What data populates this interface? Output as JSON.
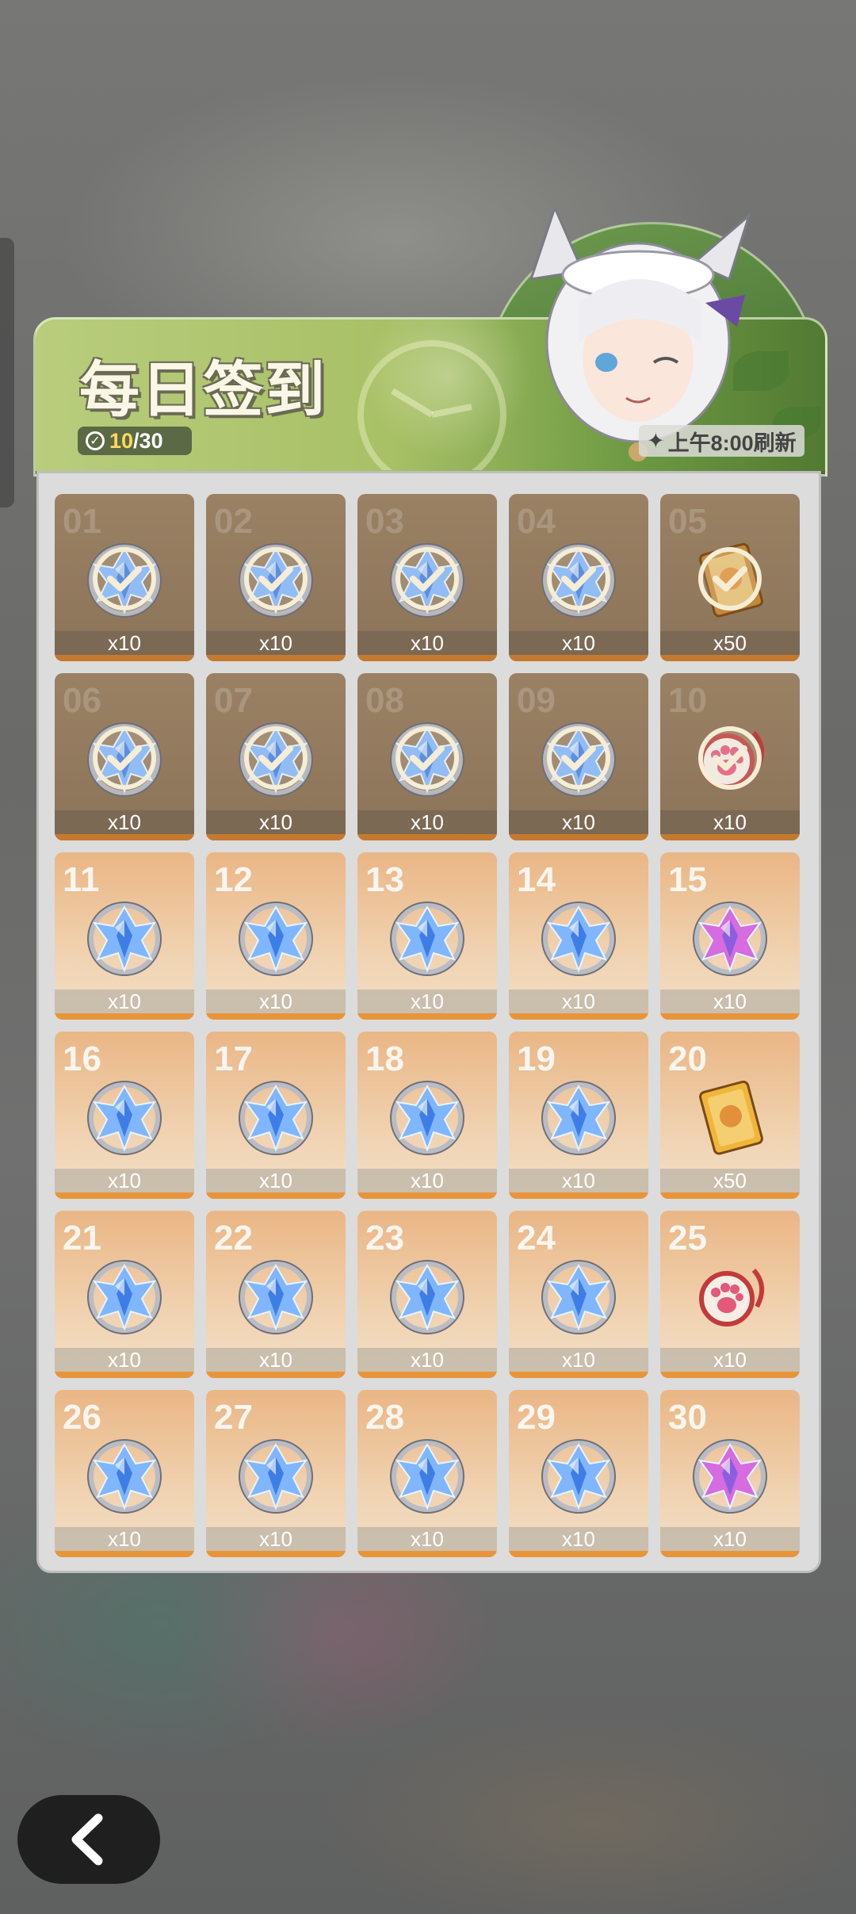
{
  "header": {
    "title": "每日签到",
    "progress_current": "10",
    "progress_total": "/30",
    "refresh_text": "上午8:00刷新"
  },
  "colors": {
    "banner_green": "#a8c066",
    "claimed_tile": "#8c7459",
    "unclaimed_tile": "#eab685",
    "accent_strip": "#e8953a"
  },
  "days": [
    {
      "day": "01",
      "qty": "x10",
      "item": "silver-crystal-icon",
      "claimed": true
    },
    {
      "day": "02",
      "qty": "x10",
      "item": "silver-crystal-icon",
      "claimed": true
    },
    {
      "day": "03",
      "qty": "x10",
      "item": "silver-crystal-icon",
      "claimed": true
    },
    {
      "day": "04",
      "qty": "x10",
      "item": "silver-crystal-icon",
      "claimed": true
    },
    {
      "day": "05",
      "qty": "x50",
      "item": "card-icon",
      "claimed": true
    },
    {
      "day": "06",
      "qty": "x10",
      "item": "silver-crystal-icon",
      "claimed": true
    },
    {
      "day": "07",
      "qty": "x10",
      "item": "silver-crystal-icon",
      "claimed": true
    },
    {
      "day": "08",
      "qty": "x10",
      "item": "silver-crystal-icon",
      "claimed": true
    },
    {
      "day": "09",
      "qty": "x10",
      "item": "silver-crystal-icon",
      "claimed": true
    },
    {
      "day": "10",
      "qty": "x10",
      "item": "paw-charm-icon",
      "claimed": true
    },
    {
      "day": "11",
      "qty": "x10",
      "item": "blue-crystal-icon",
      "claimed": false
    },
    {
      "day": "12",
      "qty": "x10",
      "item": "blue-crystal-icon",
      "claimed": false
    },
    {
      "day": "13",
      "qty": "x10",
      "item": "blue-crystal-icon",
      "claimed": false
    },
    {
      "day": "14",
      "qty": "x10",
      "item": "blue-crystal-icon",
      "claimed": false
    },
    {
      "day": "15",
      "qty": "x10",
      "item": "purple-crystal-icon",
      "claimed": false
    },
    {
      "day": "16",
      "qty": "x10",
      "item": "blue-crystal-icon",
      "claimed": false
    },
    {
      "day": "17",
      "qty": "x10",
      "item": "blue-crystal-icon",
      "claimed": false
    },
    {
      "day": "18",
      "qty": "x10",
      "item": "blue-crystal-icon",
      "claimed": false
    },
    {
      "day": "19",
      "qty": "x10",
      "item": "blue-crystal-icon",
      "claimed": false
    },
    {
      "day": "20",
      "qty": "x50",
      "item": "gold-card-icon",
      "claimed": false
    },
    {
      "day": "21",
      "qty": "x10",
      "item": "blue-crystal-icon",
      "claimed": false
    },
    {
      "day": "22",
      "qty": "x10",
      "item": "blue-crystal-icon",
      "claimed": false
    },
    {
      "day": "23",
      "qty": "x10",
      "item": "blue-crystal-icon",
      "claimed": false
    },
    {
      "day": "24",
      "qty": "x10",
      "item": "blue-crystal-icon",
      "claimed": false
    },
    {
      "day": "25",
      "qty": "x10",
      "item": "paw-charm-icon",
      "claimed": false
    },
    {
      "day": "26",
      "qty": "x10",
      "item": "blue-crystal-icon",
      "claimed": false
    },
    {
      "day": "27",
      "qty": "x10",
      "item": "blue-crystal-icon",
      "claimed": false
    },
    {
      "day": "28",
      "qty": "x10",
      "item": "blue-crystal-icon",
      "claimed": false
    },
    {
      "day": "29",
      "qty": "x10",
      "item": "blue-crystal-icon",
      "claimed": false
    },
    {
      "day": "30",
      "qty": "x10",
      "item": "purple-crystal-icon",
      "claimed": false
    }
  ]
}
